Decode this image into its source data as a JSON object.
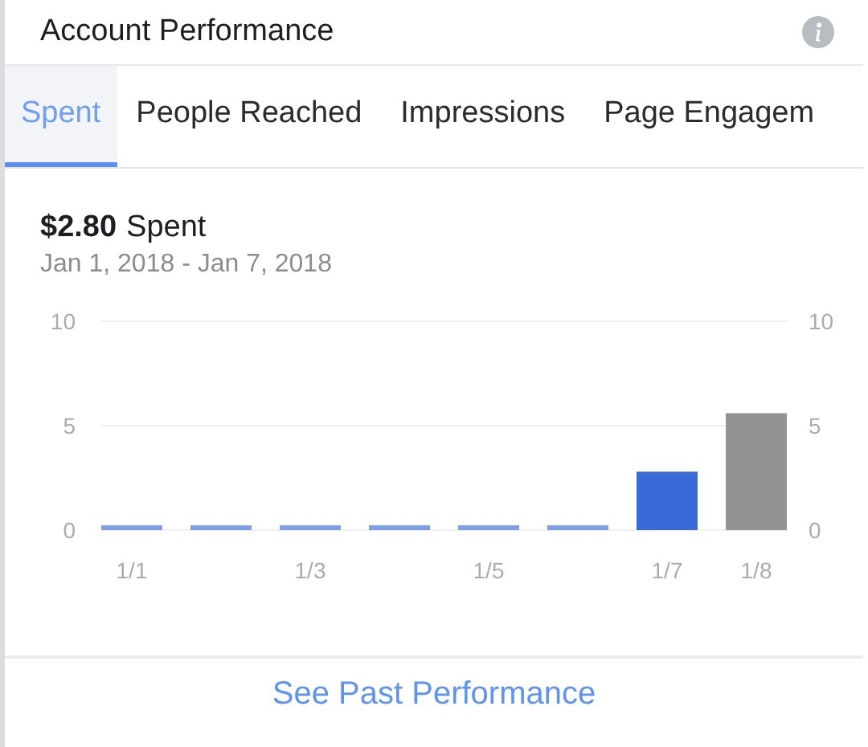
{
  "header": {
    "title": "Account Performance"
  },
  "tabs": [
    {
      "label": "Spent",
      "selected": true
    },
    {
      "label": "People Reached",
      "selected": false
    },
    {
      "label": "Impressions",
      "selected": false
    },
    {
      "label": "Page Engagem",
      "selected": false
    }
  ],
  "summary": {
    "amount": "$2.80",
    "label": "Spent",
    "date_range": "Jan 1, 2018 - Jan 7, 2018"
  },
  "chart_data": {
    "type": "bar",
    "categories": [
      "1/1",
      null,
      "1/3",
      null,
      "1/5",
      null,
      "1/7",
      "1/8"
    ],
    "series": [
      {
        "color": "#3a6ad8",
        "values": [
          0,
          0,
          0,
          0,
          0,
          0,
          2.8,
          null
        ]
      },
      {
        "color": "#939396",
        "values": [
          null,
          null,
          null,
          null,
          null,
          null,
          null,
          5.6
        ]
      }
    ],
    "ylim": [
      0,
      10
    ],
    "yticks": [
      0,
      5,
      10
    ],
    "y2lim": [
      0,
      10
    ],
    "y2ticks": [
      0,
      5,
      10
    ]
  },
  "footer": {
    "link": "See Past Performance"
  }
}
